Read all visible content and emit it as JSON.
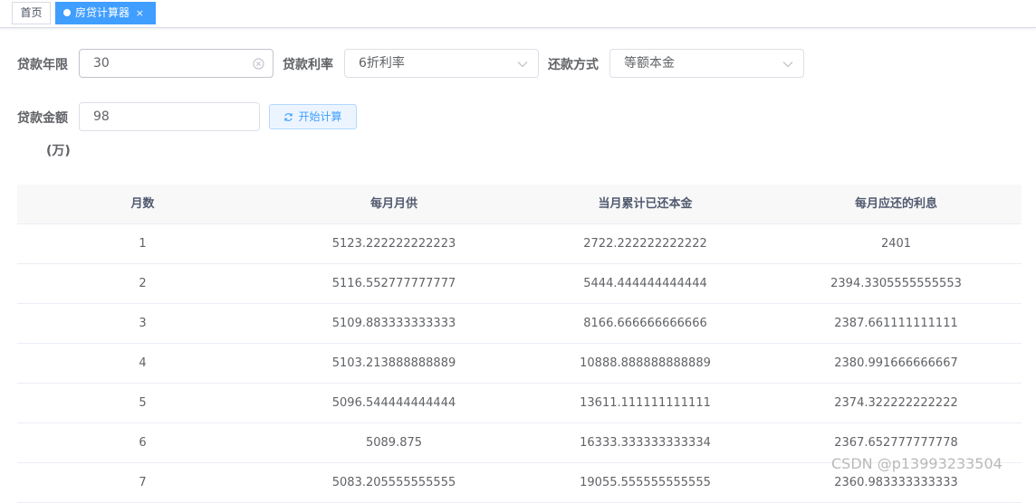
{
  "tabs": {
    "home_label": "首页",
    "active_label": "房贷计算器",
    "close_glyph": "×"
  },
  "form": {
    "term_label": "贷款年限",
    "term_value": "30",
    "rate_label": "贷款利率",
    "rate_value": "6折利率",
    "method_label": "还款方式",
    "method_value": "等额本金",
    "amount_label": "贷款金额",
    "amount_unit": "(万)",
    "amount_value": "98",
    "calc_button": "开始计算"
  },
  "table": {
    "headers": [
      "月数",
      "每月月供",
      "当月累计已还本金",
      "每月应还的利息"
    ],
    "rows": [
      [
        "1",
        "5123.222222222223",
        "2722.222222222222",
        "2401"
      ],
      [
        "2",
        "5116.552777777777",
        "5444.444444444444",
        "2394.3305555555553"
      ],
      [
        "3",
        "5109.883333333333",
        "8166.666666666666",
        "2387.661111111111"
      ],
      [
        "4",
        "5103.213888888889",
        "10888.888888888889",
        "2380.991666666667"
      ],
      [
        "5",
        "5096.544444444444",
        "13611.111111111111",
        "2374.322222222222"
      ],
      [
        "6",
        "5089.875",
        "16333.333333333334",
        "2367.652777777778"
      ],
      [
        "7",
        "5083.205555555555",
        "19055.555555555555",
        "2360.983333333333"
      ]
    ]
  },
  "watermark": "CSDN @p13993233504",
  "colors": {
    "accent": "#409eff",
    "header_bg": "#f8f8f9",
    "border": "#dcdfe6"
  }
}
